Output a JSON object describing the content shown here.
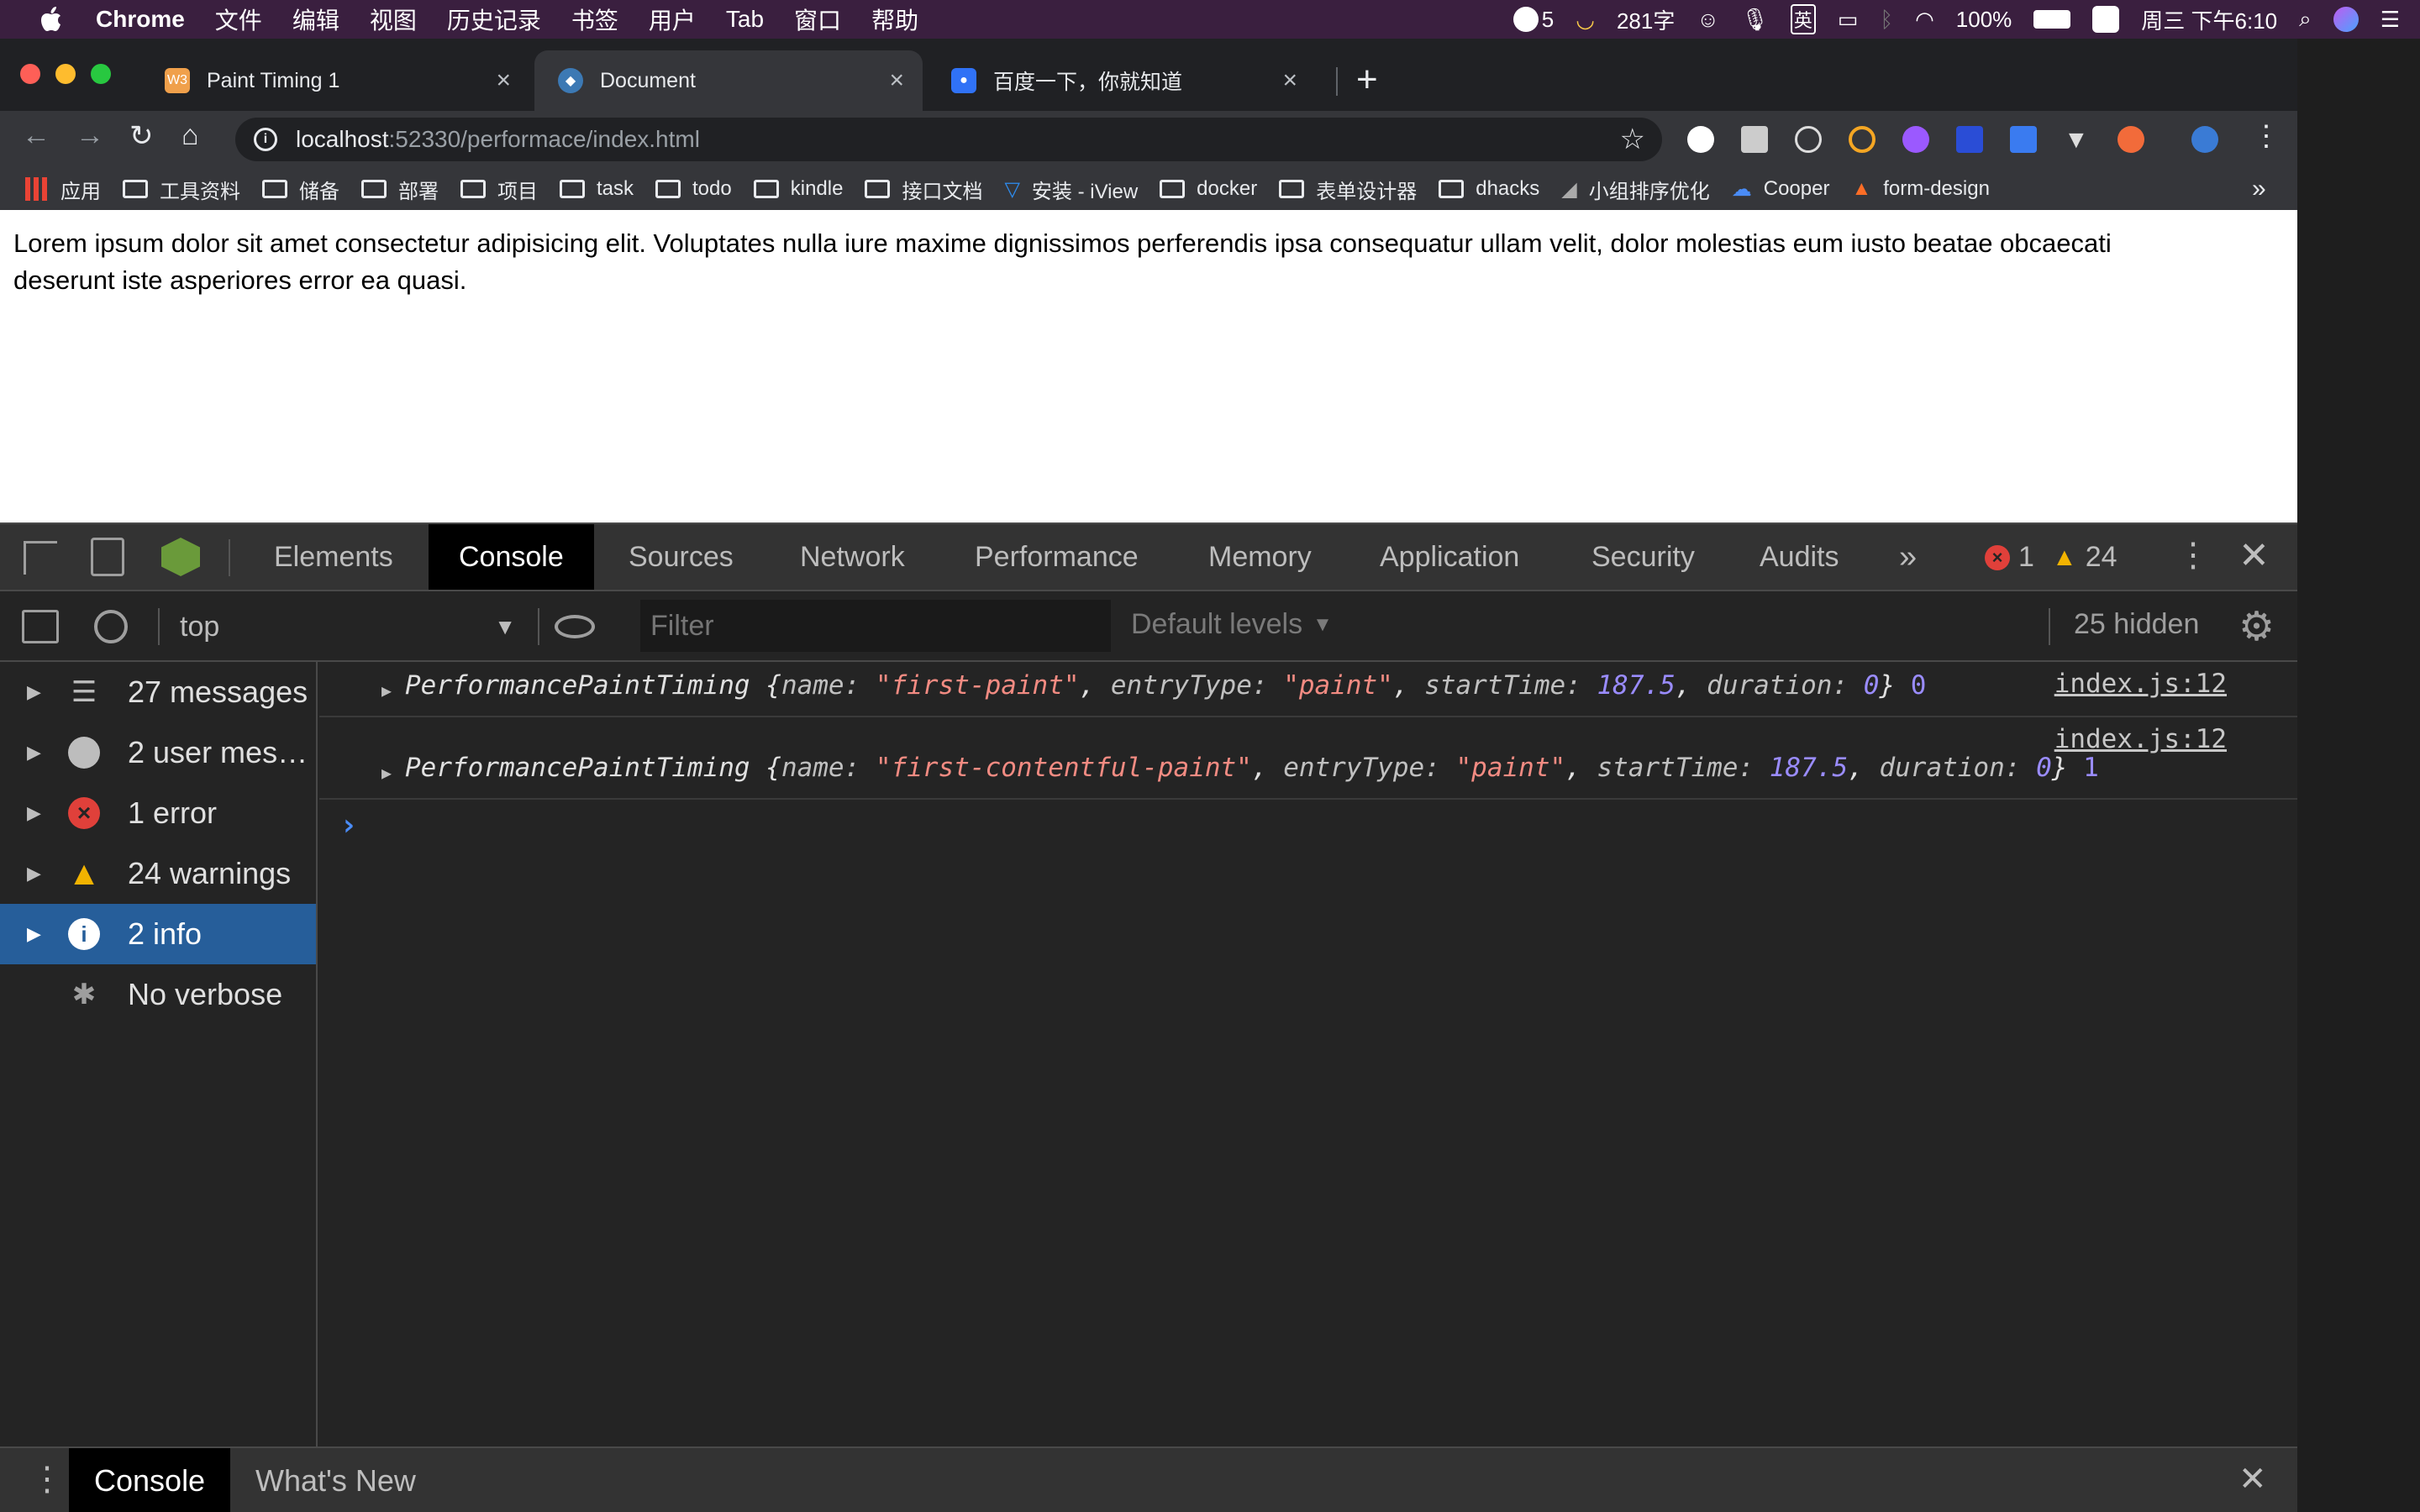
{
  "menubar": {
    "app_name": "Chrome",
    "items": [
      "文件",
      "编辑",
      "视图",
      "历史记录",
      "书签",
      "用户",
      "Tab",
      "窗口",
      "帮助"
    ],
    "status": {
      "notif_count": "5",
      "word_count": "281字",
      "ime": "英",
      "battery": "100%",
      "datetime": "周三 下午6:10"
    }
  },
  "tabs": [
    {
      "title": "Paint Timing 1",
      "favicon": "w3c-icon",
      "active": false
    },
    {
      "title": "Document",
      "favicon": "vscode-icon",
      "active": true
    },
    {
      "title": "百度一下，你就知道",
      "favicon": "baidu-paw-icon",
      "active": false
    }
  ],
  "address_bar": {
    "host": "localhost",
    "rest": ":52330/performace/index.html"
  },
  "bookmarks": [
    {
      "label": "应用",
      "icon": "apps-grid-icon"
    },
    {
      "label": "工具资料",
      "icon": "folder-icon"
    },
    {
      "label": "储备",
      "icon": "folder-icon"
    },
    {
      "label": "部署",
      "icon": "folder-icon"
    },
    {
      "label": "项目",
      "icon": "folder-icon"
    },
    {
      "label": "task",
      "icon": "folder-icon"
    },
    {
      "label": "todo",
      "icon": "folder-icon"
    },
    {
      "label": "kindle",
      "icon": "folder-icon"
    },
    {
      "label": "接口文档",
      "icon": "folder-icon"
    },
    {
      "label": "安装 - iView",
      "icon": "iview-icon"
    },
    {
      "label": "docker",
      "icon": "folder-icon"
    },
    {
      "label": "表单设计器",
      "icon": "folder-icon"
    },
    {
      "label": "dhacks",
      "icon": "folder-icon"
    },
    {
      "label": "小组排序优化",
      "icon": "bookmark-icon"
    },
    {
      "label": "Cooper",
      "icon": "cooper-icon"
    },
    {
      "label": "form-design",
      "icon": "gitlab-icon"
    }
  ],
  "bookmarks_overflow": "»",
  "page": {
    "text": "Lorem ipsum dolor sit amet consectetur adipisicing elit. Voluptates nulla iure maxime dignissimos perferendis ipsa consequatur ullam velit, dolor molestias eum iusto beatae obcaecati deserunt iste asperiores error ea quasi."
  },
  "devtools": {
    "tabs": [
      "Elements",
      "Console",
      "Sources",
      "Network",
      "Performance",
      "Memory",
      "Application",
      "Security",
      "Audits"
    ],
    "active_tab": "Console",
    "more": "»",
    "error_count": "1",
    "warning_count": "24",
    "context": "top",
    "filter_placeholder": "Filter",
    "levels": "Default levels",
    "hidden": "25 hidden",
    "sidebar": [
      {
        "label": "27 messages",
        "icon": "list-icon"
      },
      {
        "label": "2 user mes…",
        "icon": "user-icon"
      },
      {
        "label": "1 error",
        "icon": "error-icon"
      },
      {
        "label": "24 warnings",
        "icon": "warning-icon"
      },
      {
        "label": "2 info",
        "icon": "info-icon",
        "active": true
      },
      {
        "label": "No verbose",
        "icon": "bug-icon"
      }
    ],
    "console": [
      {
        "class": "PerformancePaintTiming",
        "name": "\"first-paint\"",
        "entryType": "\"paint\"",
        "startTime": "187.5",
        "duration": "0",
        "index": "0",
        "source": "index.js:12"
      },
      {
        "class": "PerformancePaintTiming",
        "name": "\"first-contentful-paint\"",
        "entryType": "\"paint\"",
        "startTime": "187.5",
        "duration": "0",
        "index": "1",
        "source": "index.js:12"
      }
    ],
    "prompt": "›",
    "drawer": {
      "tabs": [
        "Console",
        "What's New"
      ]
    }
  },
  "colors": {
    "accent": "#265e9a",
    "error": "#e0403a",
    "warning": "#f2b300",
    "string": "#f28b82",
    "number": "#9a8cff"
  }
}
